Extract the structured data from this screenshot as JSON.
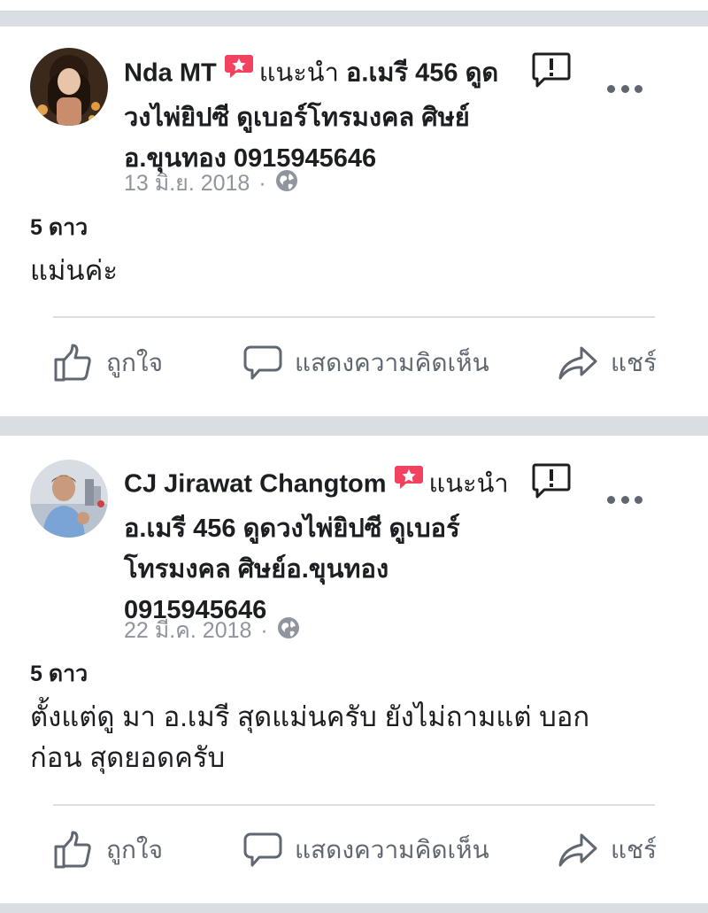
{
  "colors": {
    "background": "#dadde1",
    "card": "#ffffff",
    "text": "#1c1e21",
    "muted": "#90949c",
    "action": "#606770",
    "recommend_badge": "#f3425f"
  },
  "icons": {
    "recommend": "recommend-star-bubble-icon",
    "privacy": "globe-icon",
    "report": "report-exclamation-icon",
    "more": "more-horizontal-icon",
    "like": "thumbs-up-icon",
    "comment": "comment-bubble-icon",
    "share": "share-arrow-icon"
  },
  "reviews": [
    {
      "author": "Nda MT",
      "recommends": "แนะนำ",
      "page_line1": "อ.เมรี 456 ดูด",
      "page_line2": "วงไพ่ยิปซี ดูเบอร์โทรมงคล ศิษย์",
      "page_line3": "อ.ขุนทอง 0915945646",
      "date": "13 มิ.ย. 2018",
      "separator": "·",
      "rating": "5 ดาว",
      "text": "แม่นค่ะ"
    },
    {
      "author": "CJ Jirawat Changtom",
      "recommends": "แนะนำ",
      "page_line1": "อ.เมรี 456 ดูดวงไพ่ยิปซี ดูเบอร์",
      "page_line2": "โทรมงคล ศิษย์อ.ขุนทอง",
      "page_line3": "0915945646",
      "date": "22 มี.ค. 2018",
      "separator": "·",
      "rating": "5 ดาว",
      "text_line1": "ตั้งแต่ดู มา อ.เมรี สุดแม่นครับ ยังไม่ถามแต่ บอก",
      "text_line2": "ก่อน สุดยอดครับ"
    }
  ],
  "actions": {
    "like": "ถูกใจ",
    "comment": "แสดงความคิดเห็น",
    "share": "แชร์"
  }
}
